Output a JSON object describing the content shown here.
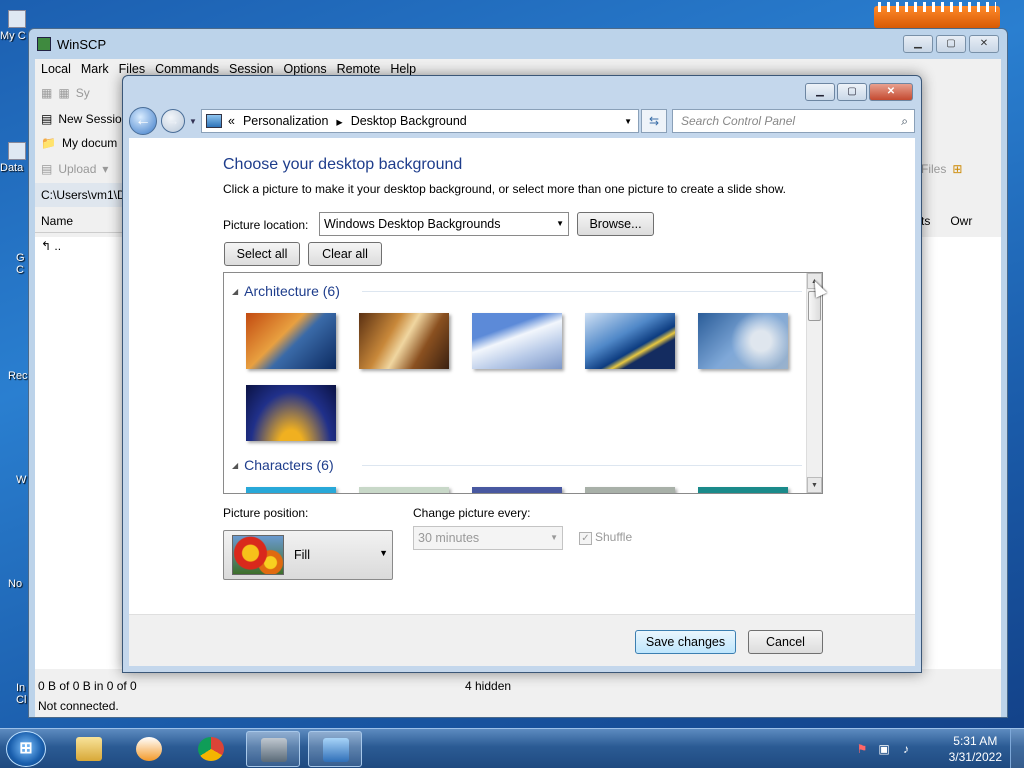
{
  "desktop": {
    "icons": [
      "My C",
      "Data",
      "G",
      "C",
      "Rec",
      "W",
      "No",
      "In",
      "Cl"
    ]
  },
  "winscp": {
    "title": "WinSCP",
    "menu": [
      "Local",
      "Mark",
      "Files",
      "Commands",
      "Session",
      "Options",
      "Remote",
      "Help"
    ],
    "toolbar_sync": "Sy",
    "new_session_tab": "New Sessio",
    "local_path_combo": "My docum",
    "upload_button": "Upload",
    "local_path": "C:\\Users\\vm1\\D",
    "col_name": "Name",
    "parent_dir": "..",
    "right_files_label": "Files",
    "col_rights": "ts",
    "col_owner": "Owr",
    "status_transfer": "0 B of 0 B in 0 of 0",
    "status_hidden": "4 hidden",
    "status_connection": "Not connected."
  },
  "dialog": {
    "breadcrumb_prefix": "«",
    "breadcrumb": [
      "Personalization",
      "Desktop Background"
    ],
    "search_placeholder": "Search Control Panel",
    "heading": "Choose your desktop background",
    "subtext": "Click a picture to make it your desktop background, or select more than one picture to create a slide show.",
    "picture_location_label": "Picture location:",
    "picture_location_value": "Windows Desktop Backgrounds",
    "browse_label": "Browse...",
    "select_all_label": "Select all",
    "clear_all_label": "Clear all",
    "groups": [
      {
        "name": "Architecture (6)"
      },
      {
        "name": "Characters (6)"
      }
    ],
    "picture_position_label": "Picture position:",
    "picture_position_value": "Fill",
    "change_every_label": "Change picture every:",
    "change_every_value": "30 minutes",
    "shuffle_label": "Shuffle",
    "shuffle_checked": true,
    "save_label": "Save changes",
    "cancel_label": "Cancel"
  },
  "taskbar": {
    "time": "5:31 AM",
    "date": "3/31/2022",
    "start_glyph": "⊞"
  }
}
